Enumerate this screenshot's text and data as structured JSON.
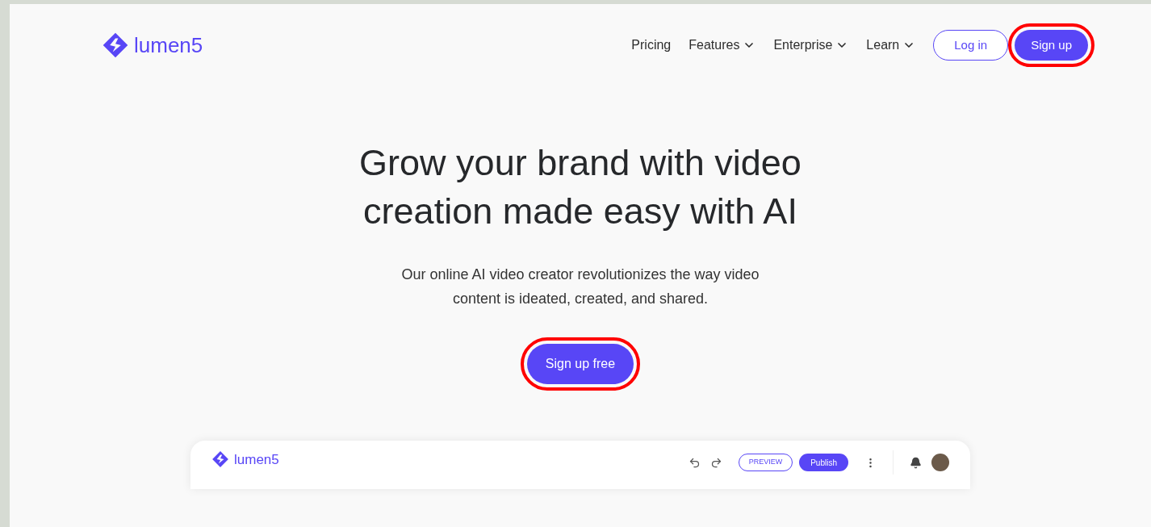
{
  "header": {
    "logo": "lumen5",
    "nav": [
      {
        "label": "Pricing",
        "dropdown": false
      },
      {
        "label": "Features",
        "dropdown": true
      },
      {
        "label": "Enterprise",
        "dropdown": true
      },
      {
        "label": "Learn",
        "dropdown": true
      }
    ],
    "login": {
      "label": "Log in",
      "highlighted": false
    },
    "signup": {
      "label": "Sign up",
      "highlighted": true
    }
  },
  "hero": {
    "title": "Grow your brand with video creation made easy with AI",
    "subtitle": "Our online AI video creator revolutionizes the way video content is ideated, created, and shared.",
    "cta": {
      "label": "Sign up free",
      "highlighted": true
    }
  },
  "app_preview": {
    "logo": "lumen5",
    "preview": "PREVIEW",
    "publish": "Publish"
  }
}
